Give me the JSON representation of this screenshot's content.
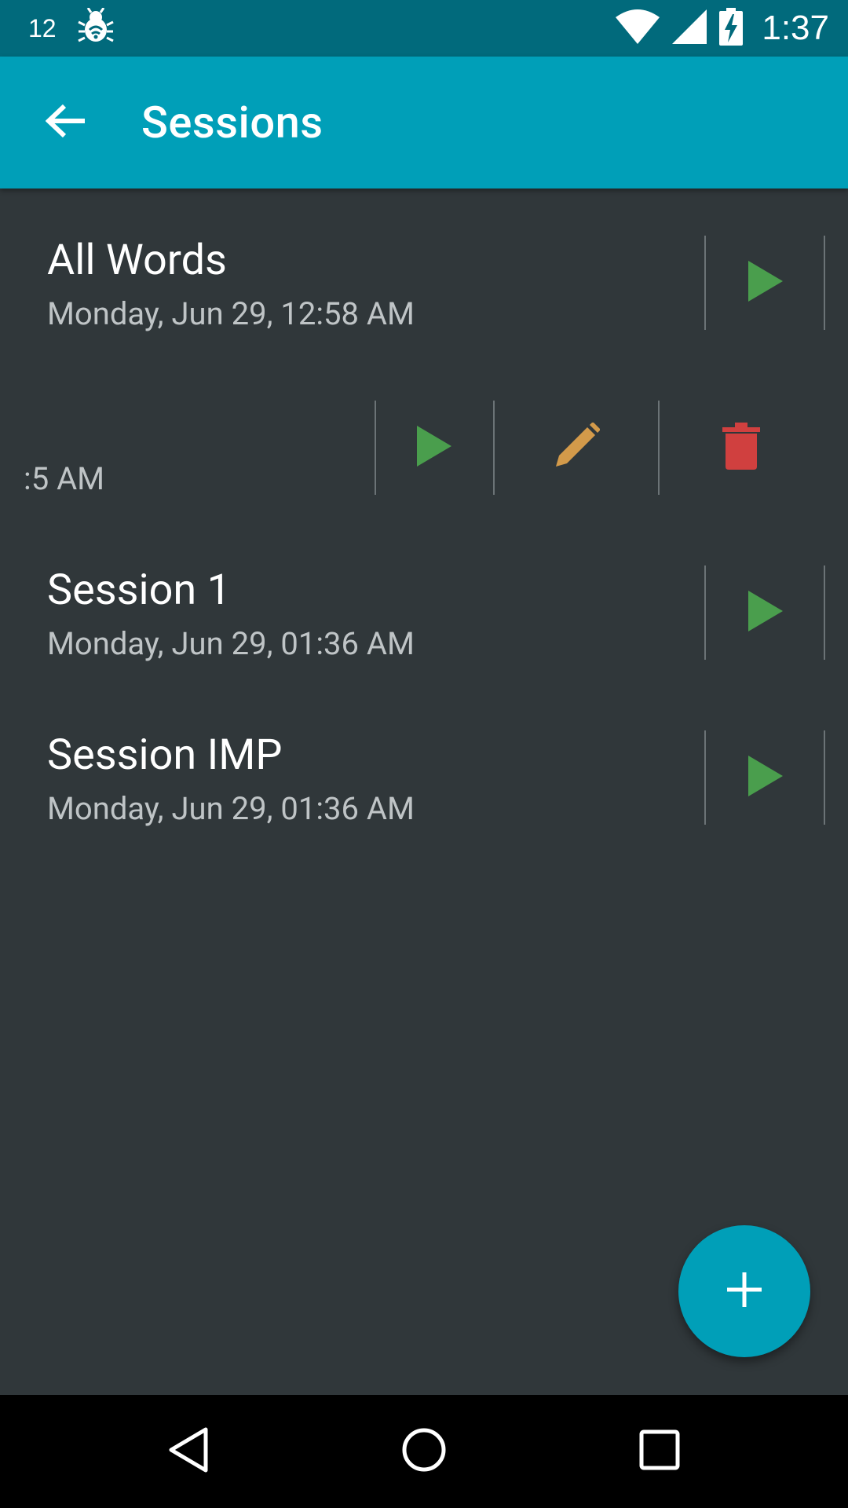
{
  "status_bar": {
    "notification_count": "12",
    "time": "1:37",
    "icons": [
      "notification-count-icon",
      "bug-icon",
      "wifi-icon",
      "signal-icon",
      "battery-charging-icon"
    ]
  },
  "app_bar": {
    "title": "Sessions",
    "back_icon": "arrow-back-icon"
  },
  "sessions": [
    {
      "name": "All Words",
      "date": "Monday, Jun 29, 12:58 AM",
      "actions": [
        "play"
      ]
    },
    {
      "name": "",
      "date": ":5 AM",
      "swiped_open": true,
      "actions": [
        "play",
        "edit",
        "delete"
      ]
    },
    {
      "name": "Session 1",
      "date": "Monday, Jun 29, 01:36 AM",
      "actions": [
        "play"
      ]
    },
    {
      "name": "Session IMP",
      "date": "Monday, Jun 29, 01:36 AM",
      "actions": [
        "play"
      ]
    }
  ],
  "fab": {
    "icon": "plus-icon"
  },
  "nav_bar": {
    "icons": [
      "back-triangle-icon",
      "home-circle-icon",
      "recents-square-icon"
    ]
  },
  "colors": {
    "status_bar": "#016a7c",
    "app_bar": "#009fb8",
    "background": "#30373a",
    "play": "#4a9e4d",
    "edit": "#d39a4a",
    "delete": "#d0403f"
  }
}
